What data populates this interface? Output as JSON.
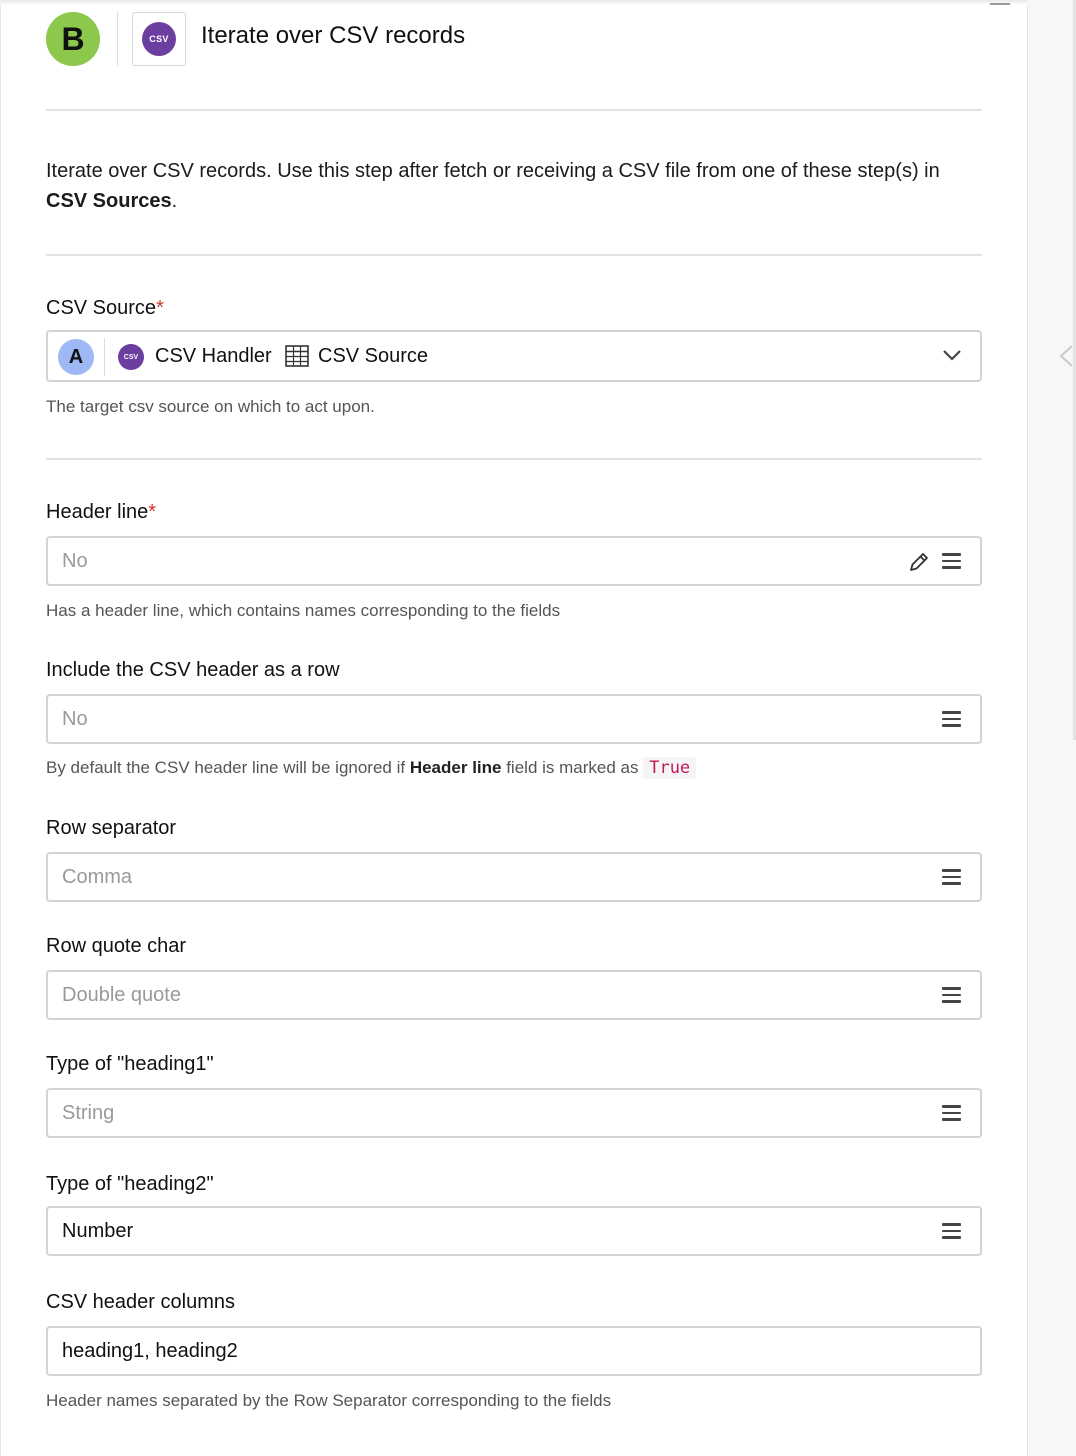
{
  "header": {
    "step_badge": "B",
    "app_icon_text": "CSV",
    "title": "Iterate over CSV records"
  },
  "description": {
    "text": "Iterate over CSV records. Use this step after fetch or receiving a CSV file from one of these step(s) in ",
    "bold": "CSV Sources",
    "suffix": "."
  },
  "csv_source": {
    "label": "CSV Source",
    "required_mark": "*",
    "step_badge": "A",
    "app_icon_text": "CSV",
    "handler": "CSV Handler",
    "source": "CSV Source",
    "help": "The target csv source on which to act upon."
  },
  "header_line": {
    "label": "Header line",
    "required_mark": "*",
    "value": "No",
    "help": "Has a header line, which contains names corresponding to the fields"
  },
  "include_header": {
    "label": "Include the CSV header as a row",
    "value": "No",
    "help_prefix": "By default the CSV header line will be ignored if ",
    "help_bold": "Header line",
    "help_mid": " field is marked as ",
    "help_code": "True"
  },
  "row_separator": {
    "label": "Row separator",
    "value": "Comma"
  },
  "row_quote_char": {
    "label": "Row quote char",
    "value": "Double quote"
  },
  "type_heading1": {
    "label": "Type of \"heading1\"",
    "value": "String"
  },
  "type_heading2": {
    "label": "Type of \"heading2\"",
    "value": "Number"
  },
  "csv_header_columns": {
    "label": "CSV header columns",
    "value": "heading1, heading2",
    "help": "Header names separated by the Row Separator corresponding to the fields"
  },
  "colors": {
    "step_b": "#8bc84b",
    "step_a": "#9db8f5",
    "csv_app": "#6b3fa0",
    "required": "#d0312d",
    "code": "#c2185b"
  }
}
